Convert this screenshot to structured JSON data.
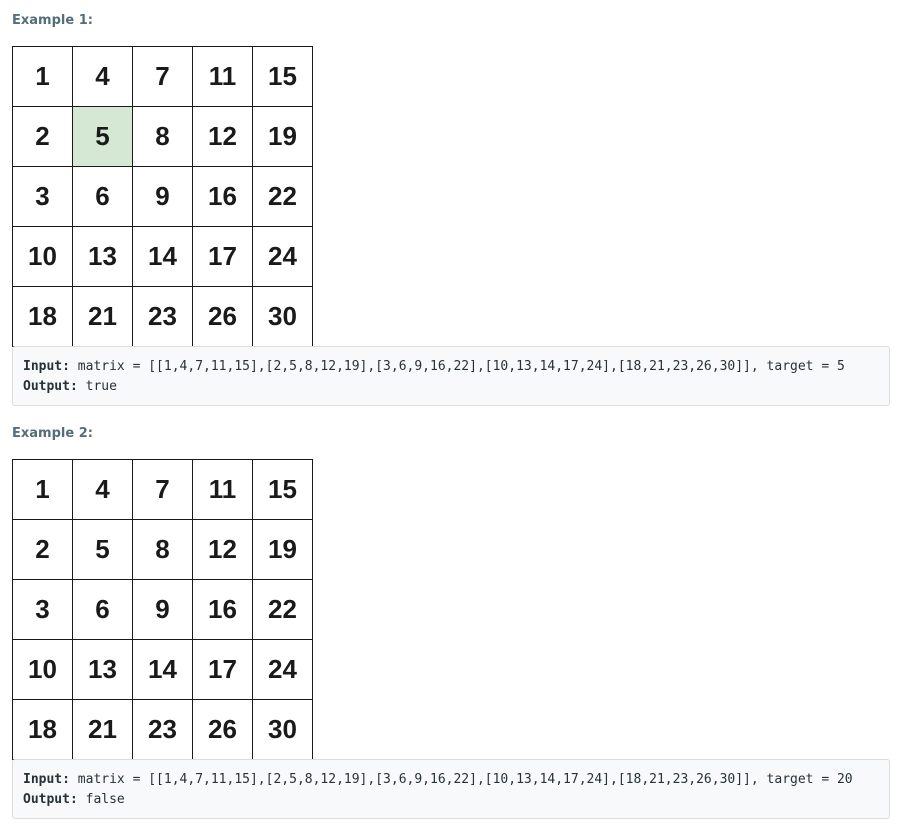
{
  "examples": [
    {
      "title": "Example 1:",
      "matrix": [
        [
          1,
          4,
          7,
          11,
          15
        ],
        [
          2,
          5,
          8,
          12,
          19
        ],
        [
          3,
          6,
          9,
          16,
          22
        ],
        [
          10,
          13,
          14,
          17,
          24
        ],
        [
          18,
          21,
          23,
          26,
          30
        ]
      ],
      "highlight_value": 5,
      "highlight_color": "#d5e8d4",
      "input_label": "Input:",
      "input_value": " matrix = [[1,4,7,11,15],[2,5,8,12,19],[3,6,9,16,22],[10,13,14,17,24],[18,21,23,26,30]], target = 5",
      "output_label": "Output:",
      "output_value": " true"
    },
    {
      "title": "Example 2:",
      "matrix": [
        [
          1,
          4,
          7,
          11,
          15
        ],
        [
          2,
          5,
          8,
          12,
          19
        ],
        [
          3,
          6,
          9,
          16,
          22
        ],
        [
          10,
          13,
          14,
          17,
          24
        ],
        [
          18,
          21,
          23,
          26,
          30
        ]
      ],
      "input_label": "Input:",
      "input_value": " matrix = [[1,4,7,11,15],[2,5,8,12,19],[3,6,9,16,22],[10,13,14,17,24],[18,21,23,26,30]], target = 20",
      "output_label": "Output:",
      "output_value": " false"
    }
  ]
}
